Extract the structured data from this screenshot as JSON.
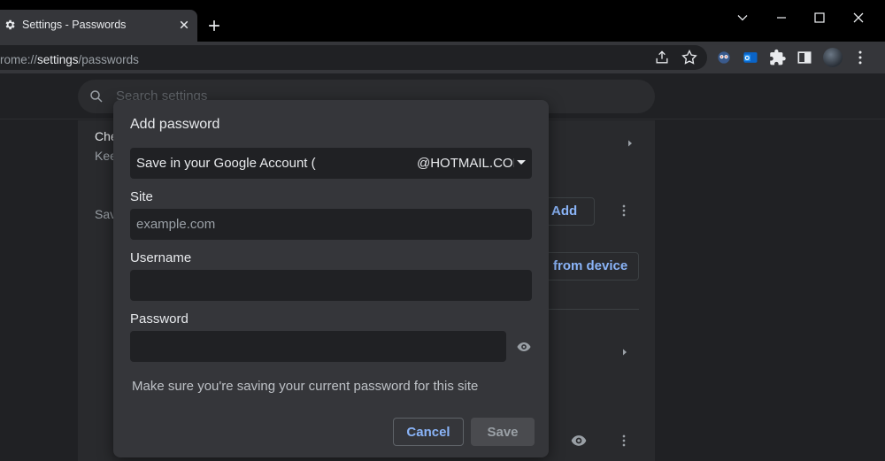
{
  "window": {
    "tab_title": "Settings - Passwords",
    "url_prefix": "rome://",
    "url_host": "settings",
    "url_path": "/passwords"
  },
  "settings": {
    "search_placeholder": "Search settings",
    "row1_title": "Che",
    "row1_sub": "Kee",
    "row2_label": "Sav",
    "add_button": "Add",
    "import_button": "from device"
  },
  "dialog": {
    "title": "Add password",
    "account_prefix": "Save in your Google Account (",
    "account_email": "@HOTMAIL.COM",
    "site_label": "Site",
    "site_placeholder": "example.com",
    "site_value": "",
    "username_label": "Username",
    "username_value": "",
    "password_label": "Password",
    "password_value": "",
    "note": "Make sure you're saving your current password for this site",
    "cancel_label": "Cancel",
    "save_label": "Save"
  },
  "colors": {
    "accent": "#8ab4f8",
    "background": "#202124",
    "dialog": "#35363a"
  }
}
